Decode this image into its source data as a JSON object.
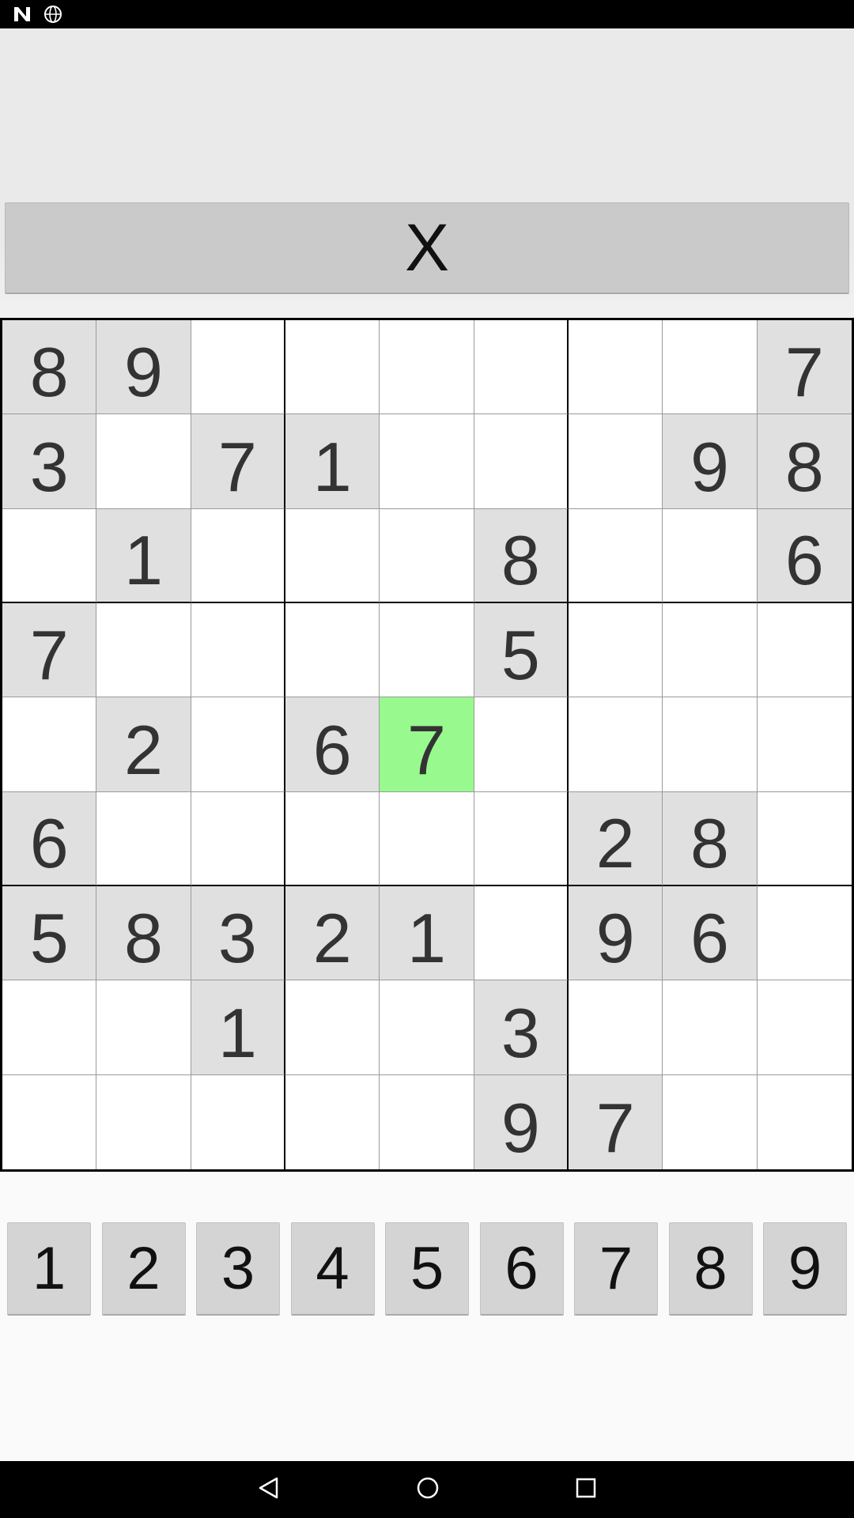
{
  "header": {
    "clear_label": "X"
  },
  "board": {
    "selected": [
      4,
      4
    ],
    "rows": [
      [
        "8",
        "9",
        "",
        "",
        "",
        "",
        "",
        "",
        "7"
      ],
      [
        "3",
        "",
        "7",
        "1",
        "",
        "",
        "",
        "9",
        "8"
      ],
      [
        "",
        "1",
        "",
        "",
        "",
        "8",
        "",
        "",
        "6"
      ],
      [
        "7",
        "",
        "",
        "",
        "",
        "5",
        "",
        "",
        ""
      ],
      [
        "",
        "2",
        "",
        "6",
        "7",
        "",
        "",
        "",
        ""
      ],
      [
        "6",
        "",
        "",
        "",
        "",
        "",
        "2",
        "8",
        ""
      ],
      [
        "5",
        "8",
        "3",
        "2",
        "1",
        "",
        "9",
        "6",
        ""
      ],
      [
        "",
        "",
        "1",
        "",
        "",
        "3",
        "",
        "",
        ""
      ],
      [
        "",
        "",
        "",
        "",
        "",
        "9",
        "7",
        "",
        ""
      ]
    ]
  },
  "numpad": {
    "keys": [
      "1",
      "2",
      "3",
      "4",
      "5",
      "6",
      "7",
      "8",
      "9"
    ]
  },
  "colors": {
    "given_cell": "#e0e0e0",
    "selected_cell": "#98f98e"
  }
}
